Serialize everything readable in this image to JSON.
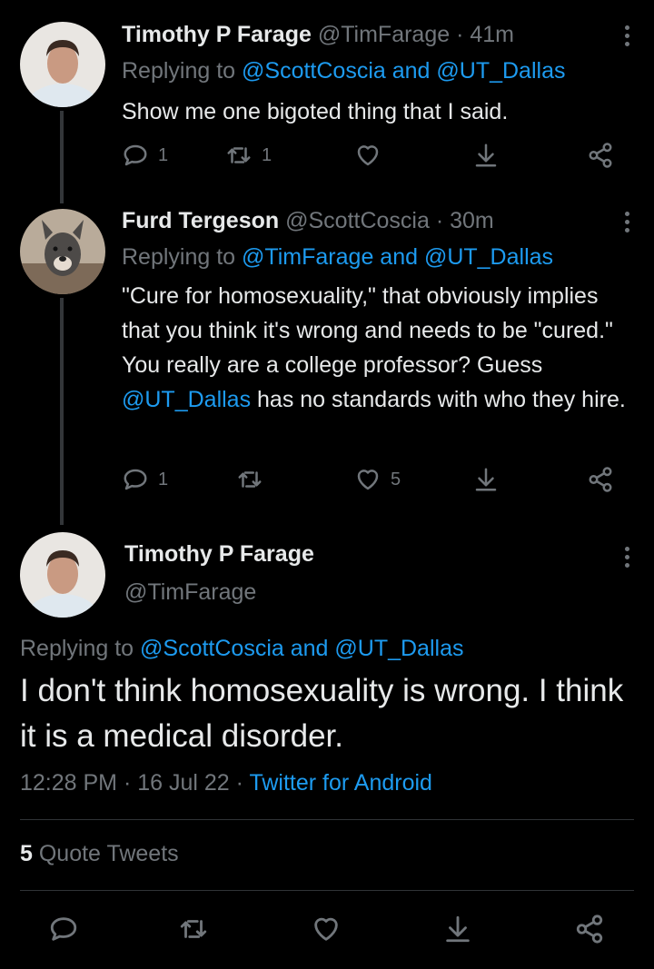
{
  "tweets": [
    {
      "name": "Timothy P Farage",
      "handle": "@TimFarage",
      "time": "· 41m",
      "replying_prefix": "Replying to",
      "replying_to": "@ScottCoscia and @UT_Dallas",
      "text": "Show me one bigoted thing that I said.",
      "replies": "1",
      "retweets": "1",
      "likes": ""
    },
    {
      "name": "Furd Tergeson",
      "handle": "@ScottCoscia",
      "time": "· 30m",
      "replying_prefix": "Replying to",
      "replying_to": "@TimFarage and @UT_Dallas",
      "text_part1": "\"Cure for homosexuality,\" that obviously implies that you think it's wrong and needs to be \"cured.\" You really are a college professor? Guess ",
      "text_mention": "@UT_Dallas",
      "text_part2": " has no standards with who they hire.",
      "replies": "1",
      "retweets": "",
      "likes": "5"
    }
  ],
  "main_tweet": {
    "name": "Timothy P Farage",
    "handle": "@TimFarage",
    "replying_prefix": "Replying to",
    "replying_to": "@ScottCoscia and @UT_Dallas",
    "text": "I don't think homosexuality is wrong. I think it is a medical disorder.",
    "timestamp": "12:28 PM · 16 Jul 22 ·",
    "source": "Twitter for Android",
    "quote_count": "5",
    "quote_label": "Quote Tweets"
  },
  "colors": {
    "background": "#000000",
    "text": "#e7e9ea",
    "secondary": "#71767b",
    "accent": "#1d9bf0"
  },
  "icons": [
    "reply-icon",
    "retweet-icon",
    "like-icon",
    "bookmark-icon",
    "share-icon",
    "more-icon"
  ]
}
